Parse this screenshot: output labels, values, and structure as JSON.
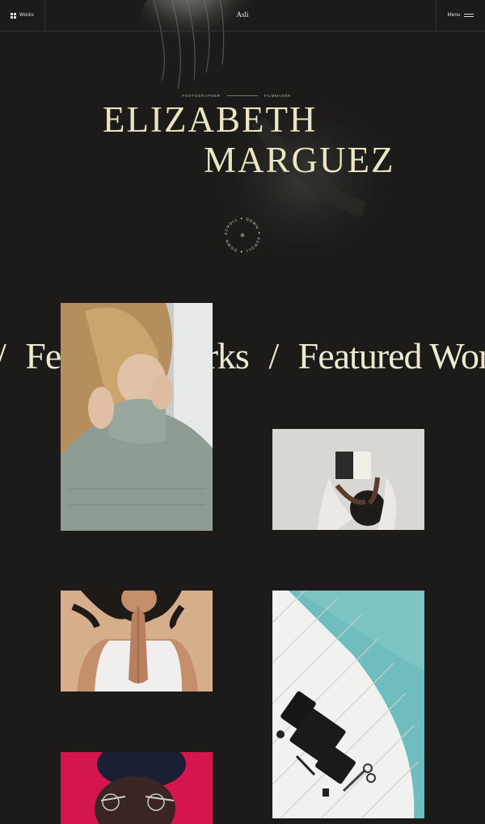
{
  "nav": {
    "works_label": "Works",
    "logo": "Asli",
    "menu_label": "Menu"
  },
  "hero": {
    "role_left": "PHOTOGRAPHER",
    "role_right": "FILMMAKER",
    "name_line1": "ELIZABETH",
    "name_line2": "MARGUEZ",
    "scroll_badge_text": "SCROLL ✦ DOWN ✦ SCROLL ✦ DOWN ✦"
  },
  "featured": {
    "marquee_text": "Featured Works",
    "separator": "/"
  },
  "works": [
    {
      "subject": "woman in grey turtleneck sweater"
    },
    {
      "subject": "person reading a book from above"
    },
    {
      "subject": "woman with hands pressed together"
    },
    {
      "subject": "desk items beside pool"
    },
    {
      "subject": "portrait with pink background"
    }
  ],
  "colors": {
    "background": "#1c1b19",
    "accent_text": "#ebe5c3",
    "divider": "#34322e"
  }
}
